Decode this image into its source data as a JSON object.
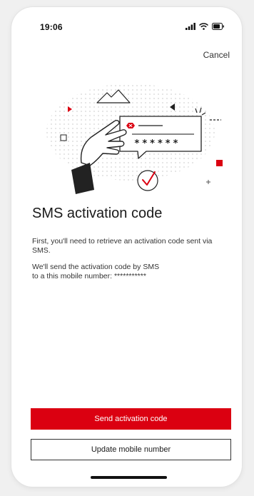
{
  "status_bar": {
    "time": "19:06"
  },
  "header": {
    "cancel_label": "Cancel"
  },
  "illustration": {
    "masked_code": "******",
    "icons": [
      "mountain-icon",
      "hand-icon",
      "sms-bubble-icon",
      "bank-logo-icon",
      "checkmark-icon"
    ],
    "accent_color": "#db0011"
  },
  "content": {
    "title": "SMS activation code",
    "paragraph_1": "First, you'll need to retrieve an activation code sent via SMS.",
    "paragraph_2_line_1": "We'll send the activation code by SMS",
    "paragraph_2_line_2": "to a this mobile number: ***********"
  },
  "actions": {
    "primary_label": "Send activation code",
    "secondary_label": "Update mobile number"
  },
  "colors": {
    "primary": "#db0011",
    "text": "#1a1a1a",
    "background": "#f0f0f0"
  }
}
